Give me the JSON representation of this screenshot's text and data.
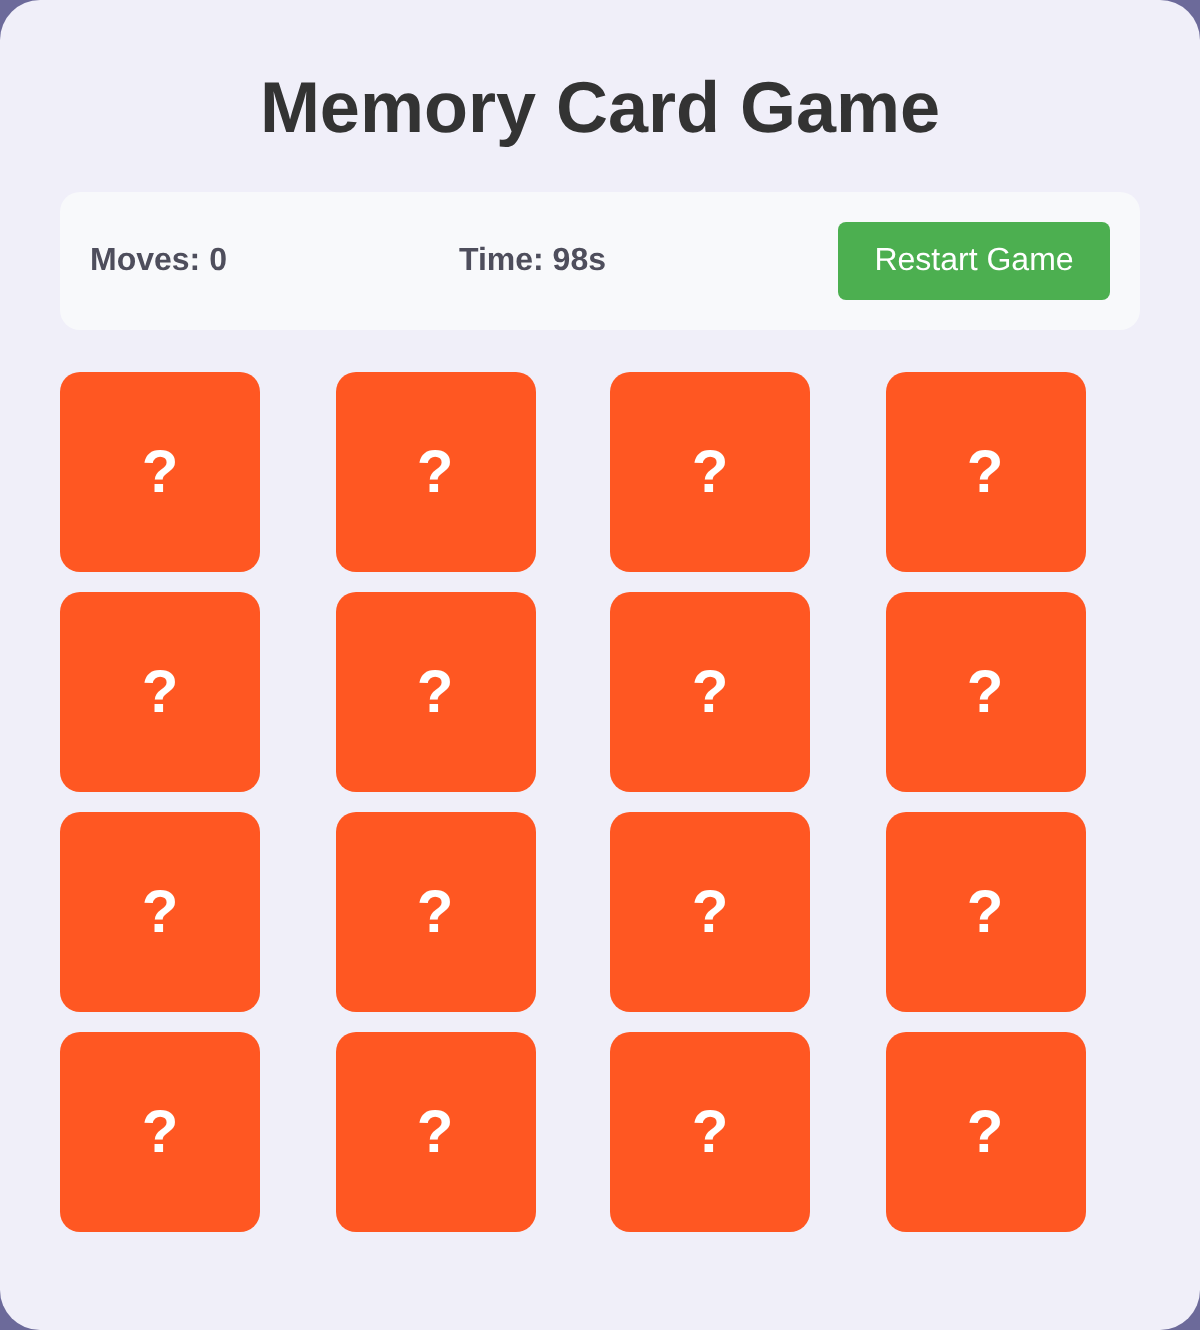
{
  "title": "Memory Card Game",
  "stats": {
    "moves": "Moves: 0",
    "time": "Time: 98s",
    "restart_button": "Restart Game"
  },
  "cards": [
    {
      "label": "?"
    },
    {
      "label": "?"
    },
    {
      "label": "?"
    },
    {
      "label": "?"
    },
    {
      "label": "?"
    },
    {
      "label": "?"
    },
    {
      "label": "?"
    },
    {
      "label": "?"
    },
    {
      "label": "?"
    },
    {
      "label": "?"
    },
    {
      "label": "?"
    },
    {
      "label": "?"
    },
    {
      "label": "?"
    },
    {
      "label": "?"
    },
    {
      "label": "?"
    },
    {
      "label": "?"
    }
  ]
}
